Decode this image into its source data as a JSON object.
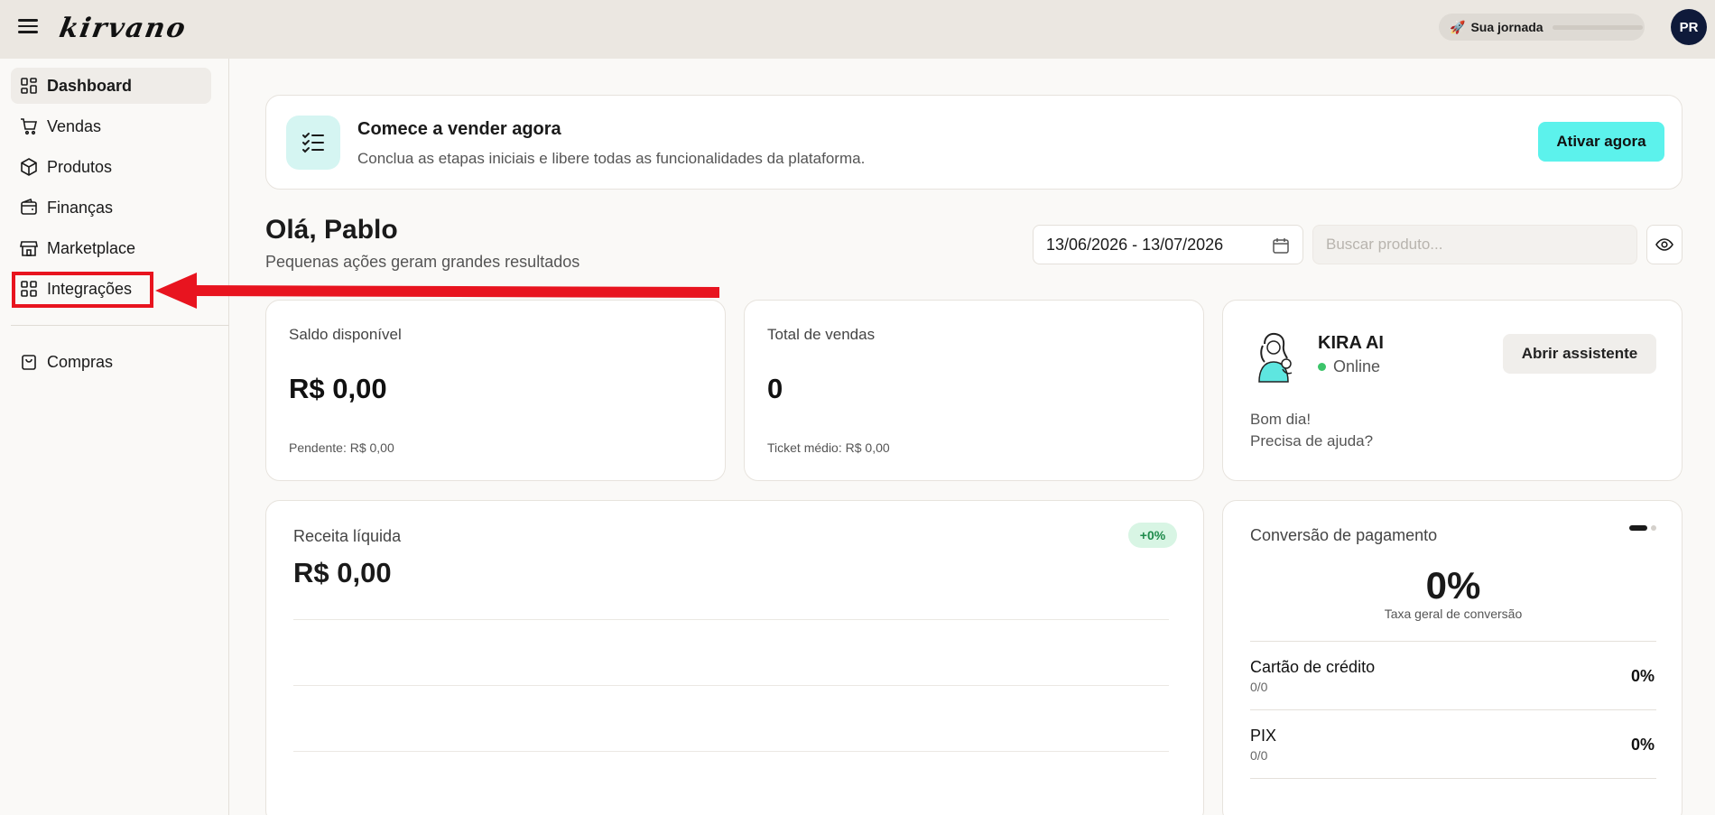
{
  "app": {
    "logo": "kirvano"
  },
  "topbar": {
    "journey_label": "Sua jornada",
    "journey_progress": 0,
    "avatar_initials": "PR"
  },
  "sidebar": {
    "items": [
      {
        "label": "Dashboard",
        "icon": "dashboard-icon",
        "active": true
      },
      {
        "label": "Vendas",
        "icon": "cart-icon"
      },
      {
        "label": "Produtos",
        "icon": "box-icon"
      },
      {
        "label": "Finanças",
        "icon": "wallet-icon"
      },
      {
        "label": "Marketplace",
        "icon": "store-icon"
      },
      {
        "label": "Integrações",
        "icon": "grid-icon"
      },
      {
        "label": "Compras",
        "icon": "bag-icon"
      }
    ]
  },
  "banner": {
    "title": "Comece a vender agora",
    "subtitle": "Conclua as etapas iniciais e libere todas as funcionalidades da plataforma.",
    "button": "Ativar agora"
  },
  "greeting": {
    "title": "Olá, Pablo",
    "subtitle": "Pequenas ações geram grandes resultados"
  },
  "filters": {
    "date_range": "13/06/2026 - 13/07/2026",
    "search_placeholder": "Buscar produto..."
  },
  "stats": {
    "balance": {
      "label": "Saldo disponível",
      "value": "R$ 0,00",
      "foot": "Pendente: R$ 0,00"
    },
    "sales": {
      "label": "Total de vendas",
      "value": "0",
      "foot": "Ticket médio: R$ 0,00"
    }
  },
  "kira": {
    "name": "KIRA AI",
    "status": "Online",
    "button": "Abrir assistente",
    "message_1": "Bom dia!",
    "message_2": "Precisa de ajuda?"
  },
  "revenue": {
    "label": "Receita líquida",
    "value": "R$ 0,00",
    "badge": "+0%"
  },
  "conversion": {
    "title": "Conversão de pagamento",
    "rate": "0%",
    "rate_label": "Taxa geral de conversão",
    "methods": [
      {
        "name": "Cartão de crédito",
        "count": "0/0",
        "pct": "0%"
      },
      {
        "name": "PIX",
        "count": "0/0",
        "pct": "0%"
      }
    ]
  },
  "colors": {
    "accent": "#5cf2ec",
    "annotation": "#e8141f",
    "topbar": "#ebe7e1",
    "online": "#3cc46a"
  }
}
